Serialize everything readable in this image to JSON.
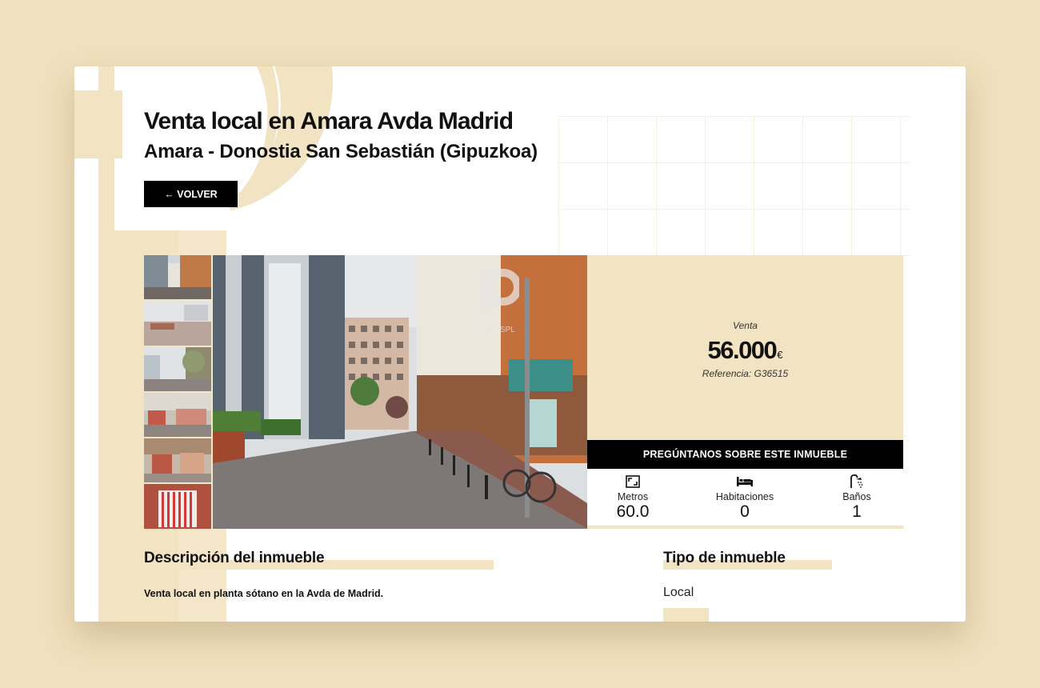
{
  "listing": {
    "title": "Venta local en Amara Avda Madrid",
    "location": "Amara - Donostia San Sebastián (Gipuzkoa)",
    "back_label": "← VOLVER"
  },
  "price_panel": {
    "operation": "Venta",
    "price": "56.000",
    "currency": "€",
    "reference": "Referencia: G36515",
    "ask_label": "PREGÚNTANOS SOBRE ESTE INMUEBLE"
  },
  "features": [
    {
      "icon": "area-icon",
      "label": "Metros",
      "value": "60.0"
    },
    {
      "icon": "bed-icon",
      "label": "Habitaciones",
      "value": "0"
    },
    {
      "icon": "shower-icon",
      "label": "Baños",
      "value": "1"
    }
  ],
  "description": {
    "heading": "Descripción del inmueble",
    "text": "Venta local en planta sótano en la Avda de Madrid."
  },
  "property_type": {
    "heading": "Tipo de inmueble",
    "value": "Local"
  },
  "watermark": "PISOSPL",
  "colors": {
    "background": "#f0e0bd",
    "accent": "#f2e3c3",
    "button": "#000000"
  }
}
